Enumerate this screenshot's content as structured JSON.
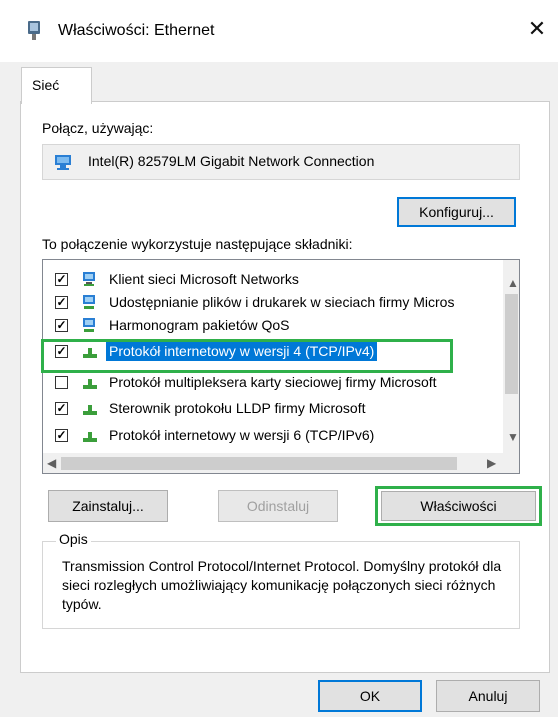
{
  "window": {
    "title": "Właściwości: Ethernet"
  },
  "tabs": [
    {
      "label": "Sieć"
    }
  ],
  "connect_using": {
    "label": "Połącz, używając:",
    "adapter_name": "Intel(R) 82579LM Gigabit Network Connection",
    "configure_button": "Konfiguruj..."
  },
  "components": {
    "label": "To połączenie wykorzystuje następujące składniki:",
    "items": [
      {
        "label": "Klient sieci Microsoft Networks",
        "checked": true
      },
      {
        "label": "Udostępnianie plików i drukarek w sieciach firmy Micros",
        "checked": true
      },
      {
        "label": "Harmonogram pakietów QoS",
        "checked": true
      },
      {
        "label": "Protokół internetowy w wersji 4 (TCP/IPv4)",
        "checked": true,
        "selected": true
      },
      {
        "label": "Protokół multipleksera karty sieciowej firmy Microsoft",
        "checked": false
      },
      {
        "label": "Sterownik protokołu LLDP firmy Microsoft",
        "checked": true
      },
      {
        "label": "Protokół internetowy w wersji 6 (TCP/IPv6)",
        "checked": true
      }
    ]
  },
  "buttons": {
    "install": "Zainstaluj...",
    "uninstall": "Odinstaluj",
    "properties": "Właściwości"
  },
  "description": {
    "label": "Opis",
    "text": "Transmission Control Protocol/Internet Protocol. Domyślny protokół dla sieci rozległych umożliwiający komunikację połączonych sieci różnych typów."
  },
  "footer": {
    "ok": "OK",
    "cancel": "Anuluj"
  },
  "colors": {
    "highlight": "#2fb04a",
    "selection": "#0078d7"
  }
}
